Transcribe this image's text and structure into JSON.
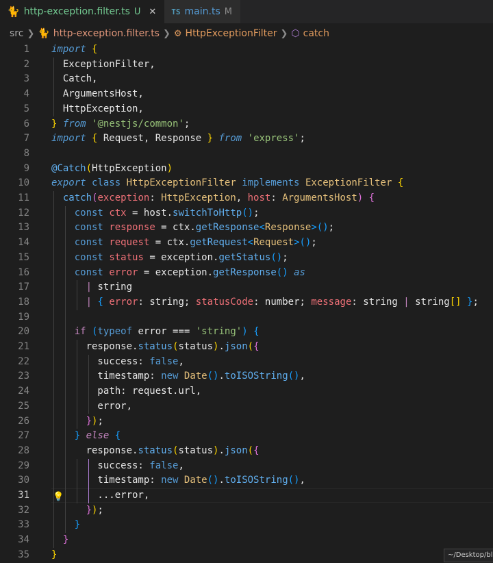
{
  "tabs": [
    {
      "name": "http-exception.filter.ts",
      "status": "U",
      "active": true
    },
    {
      "name": "main.ts",
      "status": "M",
      "active": false,
      "badge": "TS"
    }
  ],
  "breadcrumb": {
    "folder": "src",
    "file": "http-exception.filter.ts",
    "class": "HttpExceptionFilter",
    "method": "catch"
  },
  "current_line": 31,
  "tooltip": "~/Desktop/bl",
  "code_lines": [
    {
      "n": 1,
      "tokens": [
        [
          "kw-i",
          "import"
        ],
        [
          "plain",
          " "
        ],
        [
          "br1",
          "{"
        ]
      ]
    },
    {
      "n": 2,
      "tokens": [
        [
          "plain",
          "  ExceptionFilter,"
        ]
      ]
    },
    {
      "n": 3,
      "tokens": [
        [
          "plain",
          "  Catch,"
        ]
      ]
    },
    {
      "n": 4,
      "tokens": [
        [
          "plain",
          "  ArgumentsHost,"
        ]
      ]
    },
    {
      "n": 5,
      "tokens": [
        [
          "plain",
          "  HttpException,"
        ]
      ]
    },
    {
      "n": 6,
      "tokens": [
        [
          "br1",
          "}"
        ],
        [
          "plain",
          " "
        ],
        [
          "kw-i",
          "from"
        ],
        [
          "plain",
          " "
        ],
        [
          "str",
          "'@nestjs/common'"
        ],
        [
          "plain",
          ";"
        ]
      ]
    },
    {
      "n": 7,
      "tokens": [
        [
          "kw-i",
          "import"
        ],
        [
          "plain",
          " "
        ],
        [
          "br1",
          "{"
        ],
        [
          "plain",
          " Request, Response "
        ],
        [
          "br1",
          "}"
        ],
        [
          "plain",
          " "
        ],
        [
          "kw-i",
          "from"
        ],
        [
          "plain",
          " "
        ],
        [
          "str",
          "'express'"
        ],
        [
          "plain",
          ";"
        ]
      ]
    },
    {
      "n": 8,
      "tokens": []
    },
    {
      "n": 9,
      "tokens": [
        [
          "fn",
          "@Catch"
        ],
        [
          "br1",
          "("
        ],
        [
          "plain",
          "HttpException"
        ],
        [
          "br1",
          ")"
        ]
      ]
    },
    {
      "n": 10,
      "tokens": [
        [
          "kw-i",
          "export"
        ],
        [
          "plain",
          " "
        ],
        [
          "kw",
          "class"
        ],
        [
          "plain",
          " "
        ],
        [
          "cls",
          "HttpExceptionFilter"
        ],
        [
          "plain",
          " "
        ],
        [
          "kw",
          "implements"
        ],
        [
          "plain",
          " "
        ],
        [
          "cls",
          "ExceptionFilter"
        ],
        [
          "plain",
          " "
        ],
        [
          "br1",
          "{"
        ]
      ]
    },
    {
      "n": 11,
      "tokens": [
        [
          "plain",
          "  "
        ],
        [
          "fn",
          "catch"
        ],
        [
          "br2",
          "("
        ],
        [
          "var",
          "exception"
        ],
        [
          "plain",
          ": "
        ],
        [
          "cls",
          "HttpException"
        ],
        [
          "plain",
          ", "
        ],
        [
          "var",
          "host"
        ],
        [
          "plain",
          ": "
        ],
        [
          "cls",
          "ArgumentsHost"
        ],
        [
          "br2",
          ")"
        ],
        [
          "plain",
          " "
        ],
        [
          "br2",
          "{"
        ]
      ]
    },
    {
      "n": 12,
      "tokens": [
        [
          "plain",
          "    "
        ],
        [
          "kw",
          "const"
        ],
        [
          "plain",
          " "
        ],
        [
          "var",
          "ctx"
        ],
        [
          "plain",
          " = host."
        ],
        [
          "fn",
          "switchToHttp"
        ],
        [
          "br3",
          "()"
        ],
        [
          "plain",
          ";"
        ]
      ]
    },
    {
      "n": 13,
      "tokens": [
        [
          "plain",
          "    "
        ],
        [
          "kw",
          "const"
        ],
        [
          "plain",
          " "
        ],
        [
          "var",
          "response"
        ],
        [
          "plain",
          " = ctx."
        ],
        [
          "fn",
          "getResponse"
        ],
        [
          "br3",
          "<"
        ],
        [
          "cls",
          "Response"
        ],
        [
          "br3",
          ">()"
        ],
        [
          "plain",
          ";"
        ]
      ]
    },
    {
      "n": 14,
      "tokens": [
        [
          "plain",
          "    "
        ],
        [
          "kw",
          "const"
        ],
        [
          "plain",
          " "
        ],
        [
          "var",
          "request"
        ],
        [
          "plain",
          " = ctx."
        ],
        [
          "fn",
          "getRequest"
        ],
        [
          "br3",
          "<"
        ],
        [
          "cls",
          "Request"
        ],
        [
          "br3",
          ">()"
        ],
        [
          "plain",
          ";"
        ]
      ]
    },
    {
      "n": 15,
      "tokens": [
        [
          "plain",
          "    "
        ],
        [
          "kw",
          "const"
        ],
        [
          "plain",
          " "
        ],
        [
          "var",
          "status"
        ],
        [
          "plain",
          " = exception."
        ],
        [
          "fn",
          "getStatus"
        ],
        [
          "br3",
          "()"
        ],
        [
          "plain",
          ";"
        ]
      ]
    },
    {
      "n": 16,
      "tokens": [
        [
          "plain",
          "    "
        ],
        [
          "kw",
          "const"
        ],
        [
          "plain",
          " "
        ],
        [
          "var",
          "error"
        ],
        [
          "plain",
          " = exception."
        ],
        [
          "fn",
          "getResponse"
        ],
        [
          "br3",
          "()"
        ],
        [
          "plain",
          " "
        ],
        [
          "kw-i",
          "as"
        ]
      ]
    },
    {
      "n": 17,
      "tokens": [
        [
          "plain",
          "      "
        ],
        [
          "kw-c",
          "|"
        ],
        [
          "plain",
          " string"
        ]
      ]
    },
    {
      "n": 18,
      "tokens": [
        [
          "plain",
          "      "
        ],
        [
          "kw-c",
          "|"
        ],
        [
          "plain",
          " "
        ],
        [
          "br3",
          "{"
        ],
        [
          "plain",
          " "
        ],
        [
          "var",
          "error"
        ],
        [
          "plain",
          ": string; "
        ],
        [
          "var",
          "statusCode"
        ],
        [
          "plain",
          ": number; "
        ],
        [
          "var",
          "message"
        ],
        [
          "plain",
          ": string "
        ],
        [
          "kw-c",
          "|"
        ],
        [
          "plain",
          " string"
        ],
        [
          "br1",
          "[]"
        ],
        [
          "plain",
          " "
        ],
        [
          "br3",
          "}"
        ],
        [
          "plain",
          ";"
        ]
      ]
    },
    {
      "n": 19,
      "tokens": []
    },
    {
      "n": 20,
      "tokens": [
        [
          "plain",
          "    "
        ],
        [
          "kw-c",
          "if"
        ],
        [
          "plain",
          " "
        ],
        [
          "br3",
          "("
        ],
        [
          "kw",
          "typeof"
        ],
        [
          "plain",
          " error === "
        ],
        [
          "str",
          "'string'"
        ],
        [
          "br3",
          ")"
        ],
        [
          "plain",
          " "
        ],
        [
          "br3",
          "{"
        ]
      ]
    },
    {
      "n": 21,
      "tokens": [
        [
          "plain",
          "      response."
        ],
        [
          "fn",
          "status"
        ],
        [
          "br1",
          "("
        ],
        [
          "plain",
          "status"
        ],
        [
          "br1",
          ")"
        ],
        [
          "plain",
          "."
        ],
        [
          "fn",
          "json"
        ],
        [
          "br1",
          "("
        ],
        [
          "br2",
          "{"
        ]
      ]
    },
    {
      "n": 22,
      "tokens": [
        [
          "plain",
          "        success: "
        ],
        [
          "kw",
          "false"
        ],
        [
          "plain",
          ","
        ]
      ]
    },
    {
      "n": 23,
      "tokens": [
        [
          "plain",
          "        timestamp: "
        ],
        [
          "kw",
          "new"
        ],
        [
          "plain",
          " "
        ],
        [
          "cls",
          "Date"
        ],
        [
          "br3",
          "()"
        ],
        [
          "plain",
          "."
        ],
        [
          "fn",
          "toISOString"
        ],
        [
          "br3",
          "()"
        ],
        [
          "plain",
          ","
        ]
      ]
    },
    {
      "n": 24,
      "tokens": [
        [
          "plain",
          "        path: request.url,"
        ]
      ]
    },
    {
      "n": 25,
      "tokens": [
        [
          "plain",
          "        error,"
        ]
      ]
    },
    {
      "n": 26,
      "tokens": [
        [
          "plain",
          "      "
        ],
        [
          "br2",
          "}"
        ],
        [
          "br1",
          ")"
        ],
        [
          "plain",
          ";"
        ]
      ]
    },
    {
      "n": 27,
      "tokens": [
        [
          "plain",
          "    "
        ],
        [
          "br3",
          "}"
        ],
        [
          "plain",
          " "
        ],
        [
          "kw-p",
          "else"
        ],
        [
          "plain",
          " "
        ],
        [
          "br3",
          "{"
        ]
      ]
    },
    {
      "n": 28,
      "tokens": [
        [
          "plain",
          "      response."
        ],
        [
          "fn",
          "status"
        ],
        [
          "br1",
          "("
        ],
        [
          "plain",
          "status"
        ],
        [
          "br1",
          ")"
        ],
        [
          "plain",
          "."
        ],
        [
          "fn",
          "json"
        ],
        [
          "br1",
          "("
        ],
        [
          "br2",
          "{"
        ]
      ]
    },
    {
      "n": 29,
      "tokens": [
        [
          "plain",
          "        success: "
        ],
        [
          "kw",
          "false"
        ],
        [
          "plain",
          ","
        ]
      ]
    },
    {
      "n": 30,
      "tokens": [
        [
          "plain",
          "        timestamp: "
        ],
        [
          "kw",
          "new"
        ],
        [
          "plain",
          " "
        ],
        [
          "cls",
          "Date"
        ],
        [
          "br3",
          "()"
        ],
        [
          "plain",
          "."
        ],
        [
          "fn",
          "toISOString"
        ],
        [
          "br3",
          "()"
        ],
        [
          "plain",
          ","
        ]
      ]
    },
    {
      "n": 31,
      "tokens": [
        [
          "plain",
          "        ...error,"
        ]
      ]
    },
    {
      "n": 32,
      "tokens": [
        [
          "plain",
          "      "
        ],
        [
          "br2",
          "}"
        ],
        [
          "br1",
          ")"
        ],
        [
          "plain",
          ";"
        ]
      ]
    },
    {
      "n": 33,
      "tokens": [
        [
          "plain",
          "    "
        ],
        [
          "br3",
          "}"
        ]
      ]
    },
    {
      "n": 34,
      "tokens": [
        [
          "plain",
          "  "
        ],
        [
          "br2",
          "}"
        ]
      ]
    },
    {
      "n": 35,
      "tokens": [
        [
          "br1",
          "}"
        ]
      ]
    }
  ]
}
